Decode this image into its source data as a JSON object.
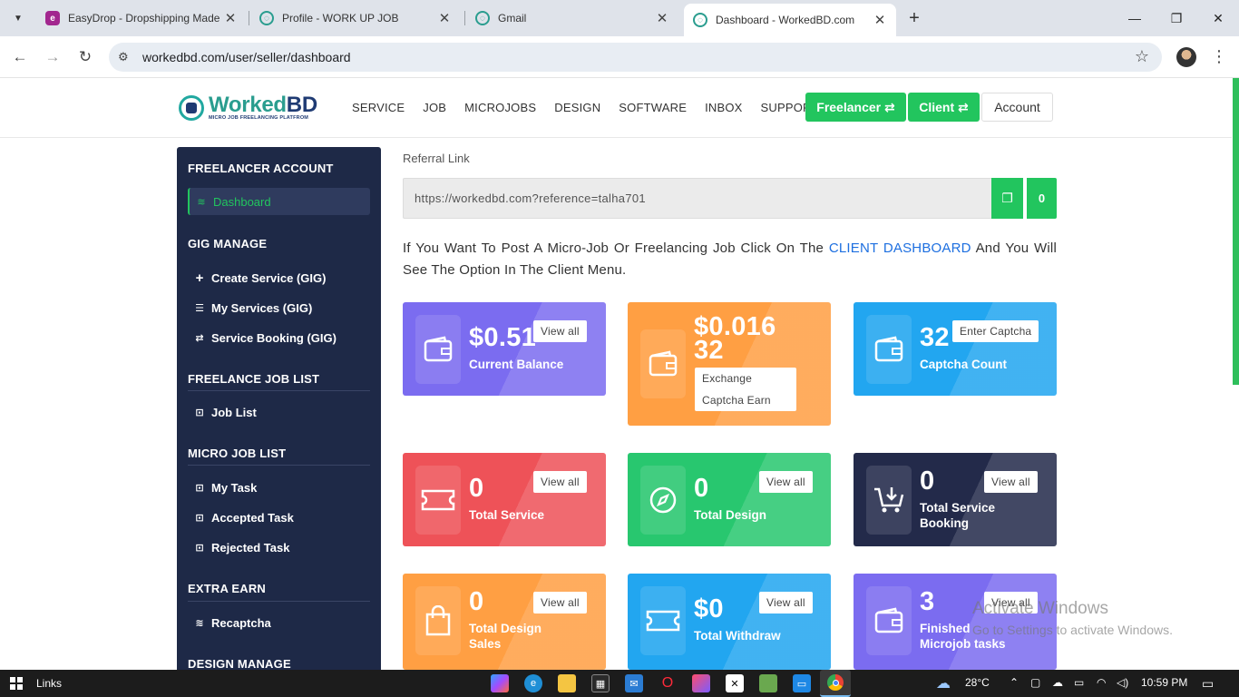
{
  "browser": {
    "tabs": [
      {
        "title": "EasyDrop - Dropshipping Made",
        "favicon": "easydrop-icon",
        "color": "#a2278f"
      },
      {
        "title": "Profile - WORK UP JOB",
        "favicon": "workupjob-icon",
        "color": "#2a9d8f"
      },
      {
        "title": "Gmail",
        "favicon": "gmail-icon",
        "color": "#2a9d8f"
      },
      {
        "title": "Dashboard - WorkedBD.com",
        "favicon": "workedbd-icon",
        "color": "#2a9d8f",
        "active": true
      }
    ],
    "url": "workedbd.com/user/seller/dashboard"
  },
  "header": {
    "logo_name_a": "Worked",
    "logo_name_b": "BD",
    "logo_tagline": "MICRO JOB FREELANCING PLATFROM",
    "nav": [
      "SERVICE",
      "JOB",
      "MICROJOBS",
      "DESIGN",
      "SOFTWARE",
      "INBOX",
      "SUPPORT"
    ],
    "freelancer_btn": "Freelancer ⇄",
    "client_btn": "Client ⇄",
    "account_btn": "Account"
  },
  "sidebar": {
    "sections": [
      {
        "heading": "FREELANCER ACCOUNT",
        "items": [
          {
            "label": "Dashboard",
            "icon": "layers-icon",
            "active": true
          }
        ]
      },
      {
        "heading": "GIG MANAGE",
        "items": [
          {
            "label": "Create Service (GIG)",
            "icon": "plus-icon"
          },
          {
            "label": "My Services (GIG)",
            "icon": "list-icon"
          },
          {
            "label": "Service Booking (GIG)",
            "icon": "exchange-icon"
          }
        ]
      },
      {
        "heading": "FREELANCE JOB LIST",
        "items": [
          {
            "label": "Job List",
            "icon": "image-icon"
          }
        ]
      },
      {
        "heading": "MICRO JOB LIST",
        "items": [
          {
            "label": "My Task",
            "icon": "image-icon"
          },
          {
            "label": "Accepted Task",
            "icon": "image-icon"
          },
          {
            "label": "Rejected Task",
            "icon": "image-icon"
          }
        ]
      },
      {
        "heading": "EXTRA EARN",
        "items": [
          {
            "label": "Recaptcha",
            "icon": "layers-icon"
          }
        ]
      },
      {
        "heading": "DESIGN MANAGE",
        "items": []
      }
    ]
  },
  "referral": {
    "label": "Referral Link",
    "link": "https://workedbd.com?reference=talha701",
    "count": "0"
  },
  "notice": {
    "before": "If You Want To Post A Micro-Job Or Freelancing Job Click On The ",
    "link": "CLIENT DASHBOARD",
    "after": " And You Will See The Option In The Client Menu."
  },
  "cards": {
    "balance": {
      "value": "$0.51",
      "label": "Current Balance",
      "button": "View all"
    },
    "captcha_earn": {
      "value_line1": "$0.016",
      "value_line2": "32",
      "button_line1": "Exchange",
      "button_line2": "Captcha Earn"
    },
    "captcha_count": {
      "value": "32",
      "label": "Captcha Count",
      "button": "Enter Captcha"
    },
    "service": {
      "value": "0",
      "label": "Total Service",
      "button": "View all"
    },
    "design": {
      "value": "0",
      "label": "Total Design",
      "button": "View all"
    },
    "booking": {
      "value": "0",
      "label_line1": "Total Service",
      "label_line2": "Booking",
      "button": "View all"
    },
    "design_sales": {
      "value": "0",
      "label_line1": "Total Design",
      "label_line2": "Sales",
      "button": "View all"
    },
    "withdraw": {
      "value": "$0",
      "label": "Total Withdraw",
      "button": "View all"
    },
    "microjob": {
      "value": "3",
      "label_line1": "Finished",
      "label_line2": "Microjob tasks",
      "button": "View all"
    }
  },
  "watermark": {
    "line1": "Activate Windows",
    "line2": "Go to Settings to activate Windows."
  },
  "taskbar": {
    "links": "Links",
    "temp": "28°C",
    "time": "10:59 PM"
  }
}
